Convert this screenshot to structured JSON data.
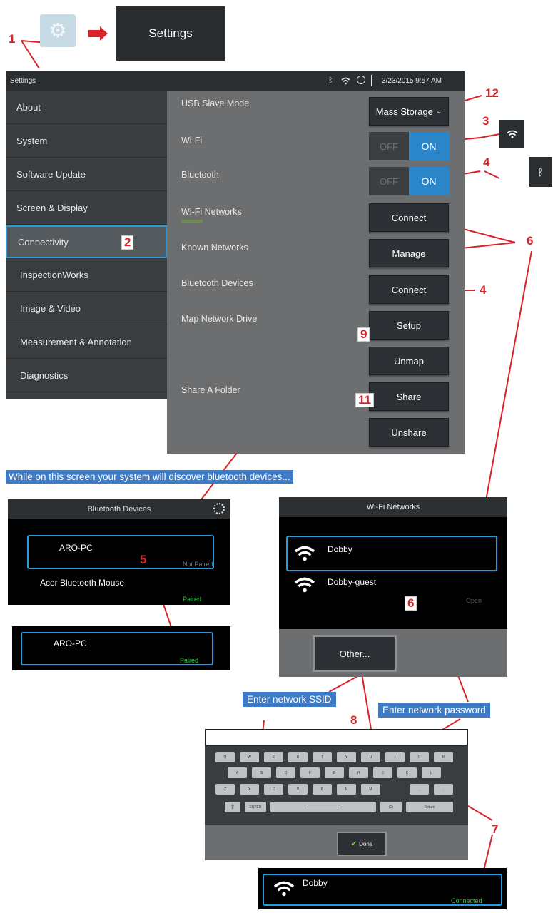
{
  "nav": {
    "settings_chip": "Settings"
  },
  "statusbar": {
    "title": "Settings",
    "datetime": "3/23/2015 9:57 AM"
  },
  "sidebar": {
    "items": [
      {
        "label": "About"
      },
      {
        "label": "System"
      },
      {
        "label": "Software Update"
      },
      {
        "label": "Screen & Display"
      },
      {
        "label": "Connectivity"
      },
      {
        "label": "InspectionWorks"
      },
      {
        "label": "Image & Video"
      },
      {
        "label": "Measurement & Annotation"
      },
      {
        "label": "Diagnostics"
      }
    ]
  },
  "panel": {
    "usb_label": "USB Slave Mode",
    "usb_value": "Mass Storage",
    "wifi_label": "Wi-Fi",
    "bluetooth_label": "Bluetooth",
    "off_label": "OFF",
    "on_label": "ON",
    "wifi_networks_label": "Wi-Fi Networks",
    "known_networks_label": "Known Networks",
    "bluetooth_devices_label": "Bluetooth Devices",
    "map_drive_label": "Map Network Drive",
    "share_folder_label": "Share A Folder",
    "connect_label": "Connect",
    "manage_label": "Manage",
    "setup_label": "Setup",
    "unmap_label": "Unmap",
    "share_label": "Share",
    "unshare_label": "Unshare"
  },
  "caption": "While on this screen your system will discover bluetooth devices...",
  "bt_dialog": {
    "title": "Bluetooth Devices",
    "device1": "ARO-PC",
    "device1_status": "Not Paired",
    "device2": "Acer Bluetooth Mouse",
    "device2_status": "Paired",
    "paired_device": "ARO-PC",
    "paired_status": "Paired"
  },
  "wifi_dialog": {
    "title": "Wi-Fi Networks",
    "net1": "Dobby",
    "net2": "Dobby-guest",
    "net2_status": "Open",
    "other_label": "Other..."
  },
  "tags": {
    "ssid": "Enter network SSID",
    "password": "Enter network password"
  },
  "keyboard": {
    "row1": [
      "Q",
      "W",
      "E",
      "R",
      "T",
      "Y",
      "U",
      "I",
      "O",
      "P"
    ],
    "row2": [
      "A",
      "S",
      "D",
      "F",
      "G",
      "H",
      "J",
      "K",
      "L"
    ],
    "row3": [
      "Z",
      "X",
      "C",
      "V",
      "B",
      "N",
      "M",
      ",",
      "."
    ],
    "shift": "⇧",
    "enter_label": "ENTER",
    "clr_label": "Clr",
    "return_label": "Return",
    "done_label": "Done"
  },
  "connected": {
    "network": "Dobby",
    "status": "Connected"
  },
  "callouts": {
    "c1": "1",
    "c2": "2",
    "c3": "3",
    "c4a": "4",
    "c4b": "4",
    "c5": "5",
    "c6a": "6",
    "c6b": "6",
    "c7": "7",
    "c8": "8",
    "c9": "9",
    "c11": "11",
    "c12": "12"
  },
  "colors": {
    "accent": "#2b9bd6",
    "toggle_on": "#2a86c9",
    "callout": "#d8232a",
    "paired": "#2ecc40",
    "highlight": "#3d7bc6"
  }
}
